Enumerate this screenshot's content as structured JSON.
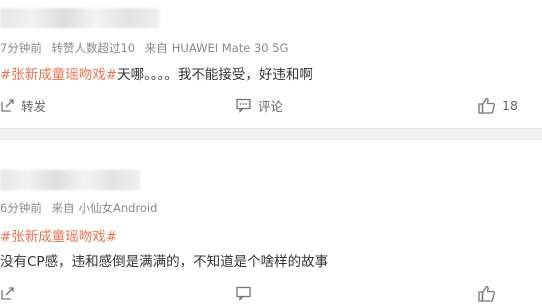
{
  "comments": [
    {
      "time": "7分钟前",
      "likes_note": "转赞人数超过10",
      "source_label": "来自",
      "source_device": "HUAWEI Mate 30 5G",
      "hashtag": "#张新成童瑶吻戏#",
      "text": "天哪。。。。我不能接受，好违和啊",
      "forward_label": "转发",
      "comment_label": "评论",
      "like_count": "18"
    },
    {
      "time": "6分钟前",
      "source_label": "来自",
      "source_device": "小仙女Android",
      "hashtag": "#张新成童瑶吻戏#",
      "text": "没有CP感，违和感倒是满满的，不知道是个啥样的故事"
    }
  ],
  "icons": {
    "forward": "forward-icon",
    "comment": "comment-icon",
    "like": "thumbs-up-icon"
  },
  "colors": {
    "hashtag": "#eb7350",
    "meta": "#8a8a8a",
    "body": "#333333",
    "divider": "#f2f2f2"
  }
}
